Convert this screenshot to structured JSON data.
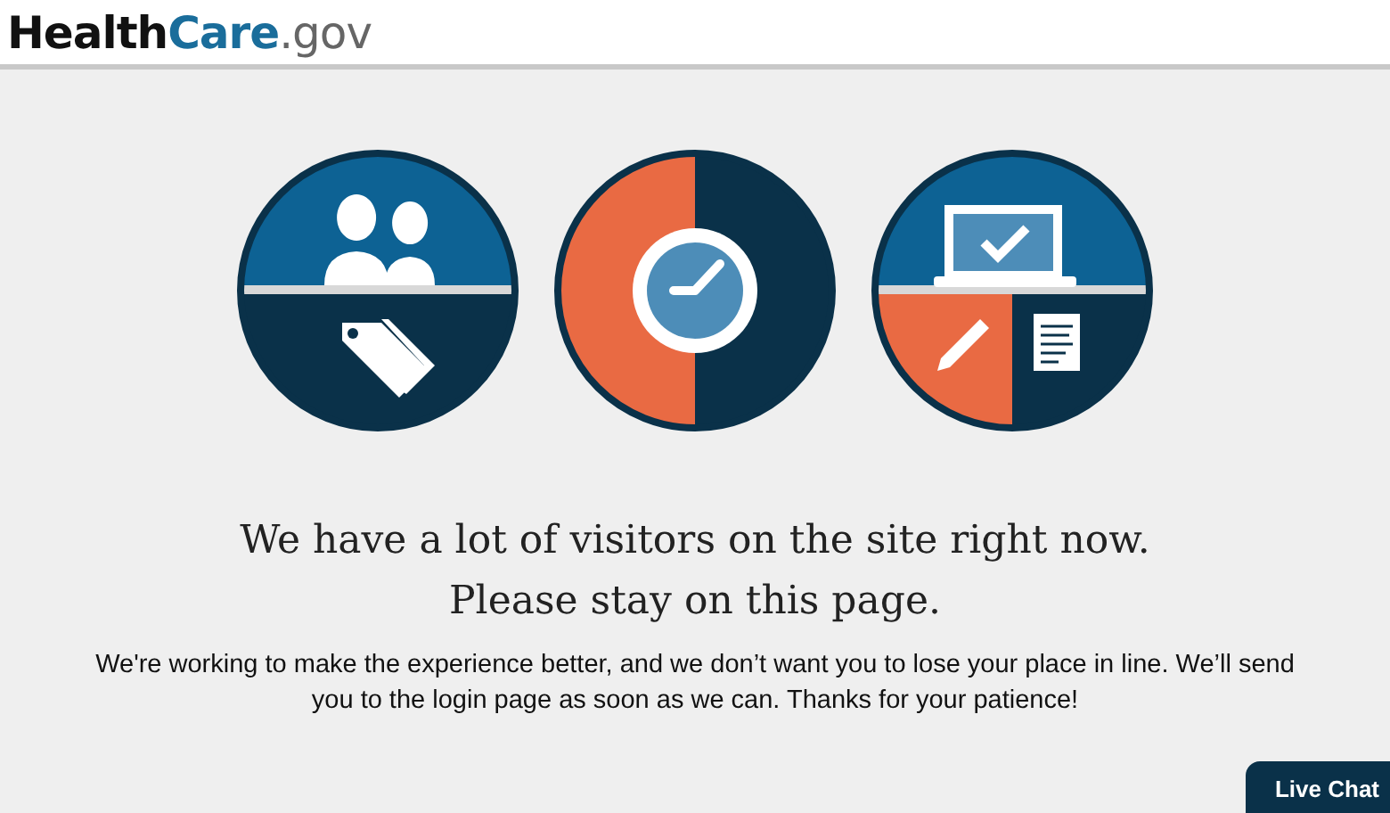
{
  "header": {
    "logo": [
      {
        "text": "Health",
        "kind": "dark"
      },
      {
        "text": "Care",
        "kind": "accent"
      },
      {
        "text": ".gov",
        "kind": "light"
      }
    ]
  },
  "illustrations": [
    {
      "kind": "people-tag"
    },
    {
      "kind": "clock"
    },
    {
      "kind": "laptop"
    }
  ],
  "headline": [
    "We have a lot of visitors on the site right now.",
    "Please stay on this page."
  ],
  "message": "We're working to make the experience better, and we don’t want you to lose your place in line. We’ll send you to the login page as soon as we can. Thanks for your patience!",
  "live_chat": {
    "label": "Live Chat"
  }
}
